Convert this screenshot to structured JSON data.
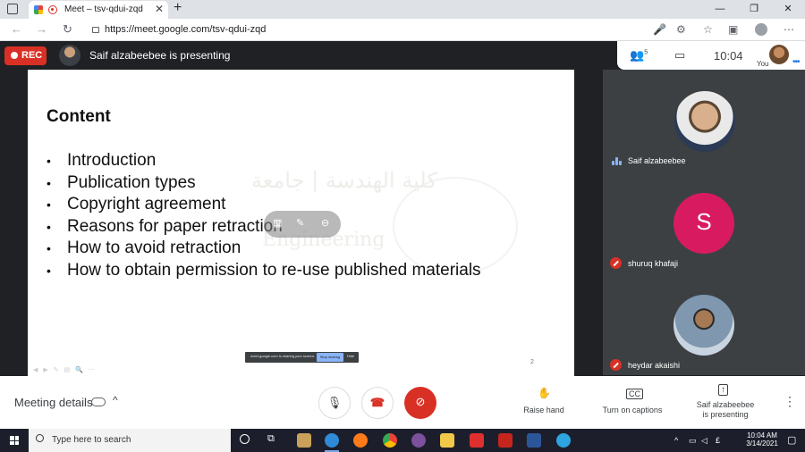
{
  "browser": {
    "tab_title": "Meet – tsv-qdui-zqd",
    "url_prefix": "https://",
    "url_host": "meet.google.com",
    "url_path": "/tsv-qdui-zqd"
  },
  "meet_header": {
    "rec_label": "REC",
    "presenting_text": "Saif alzabeebee is presenting",
    "participant_count": "5",
    "clock": "10:04",
    "you_label": "You"
  },
  "slide": {
    "title": "Content",
    "bullets": [
      "Introduction",
      "Publication types",
      "Copyright agreement",
      "Reasons for paper retraction",
      "How to avoid retraction",
      "How to obtain permission to re-use published materials"
    ],
    "slide_number": "2",
    "share_bar_text": "meet.google.com is sharing your screen.",
    "stop_sharing_label": "Stop sharing",
    "hide_label": "Hide"
  },
  "participants": [
    {
      "name": "Saif alzabeebee",
      "avatar_type": "photo",
      "mic": "active"
    },
    {
      "name": "shuruq khafaji",
      "avatar_type": "initial",
      "initial": "S",
      "avatar_color": "#d81b60",
      "mic": "muted"
    },
    {
      "name": "heydar akaishi",
      "avatar_type": "photo",
      "mic": "muted"
    }
  ],
  "bottom_bar": {
    "meeting_details_label": "Meeting details",
    "raise_hand_label": "Raise hand",
    "captions_label": "Turn on captions",
    "presenting_label_line1": "Saif alzabeebee",
    "presenting_label_line2": "is presenting"
  },
  "taskbar": {
    "search_placeholder": "Type here to search",
    "time": "10:04 AM",
    "date": "3/14/2021"
  },
  "colors": {
    "meet_dark": "#202124",
    "tile_bg": "#3c4043",
    "red": "#d93025",
    "accent_blue": "#1a73e8"
  }
}
